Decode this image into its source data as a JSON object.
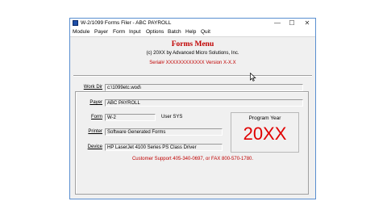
{
  "window": {
    "title": "W-2/1099 Forms Filer - ABC PAYROLL",
    "controls": {
      "minimize": "—",
      "maximize": "☐",
      "close": "✕"
    }
  },
  "menu": [
    "Module",
    "Payer",
    "Form",
    "Input",
    "Options",
    "Batch",
    "Help",
    "Quit"
  ],
  "header": {
    "title": "Forms Menu",
    "copyright": "(c) 20XX by Advanced Micro Solutions, Inc.",
    "serial": "Serial# XXXXXXXXXXXX   Version X-X.X"
  },
  "fields": {
    "work_dir": {
      "label": "Work Dir",
      "value": "c:\\1099etc.wod\\"
    },
    "payer": {
      "label": "Payer",
      "value": "ABC PAYROLL"
    },
    "form": {
      "label": "Form",
      "value": "W-2"
    },
    "user": "User SYS",
    "printer": {
      "label": "Printer",
      "value": "Software Generated Forms"
    },
    "device": {
      "label": "Device",
      "value": "HP LaserJet 4100 Series PS Class Driver"
    }
  },
  "program_year": {
    "label": "Program Year",
    "value": "20XX"
  },
  "support": "Customer Support 405-340-0697,  or   FAX  800-570-1780.",
  "colors": {
    "accent_red": "#c00000",
    "year_red": "#e00000",
    "window_border": "#5a8fd0"
  },
  "icons": {
    "app": "app-icon",
    "cursor": "mouse-pointer-icon"
  }
}
